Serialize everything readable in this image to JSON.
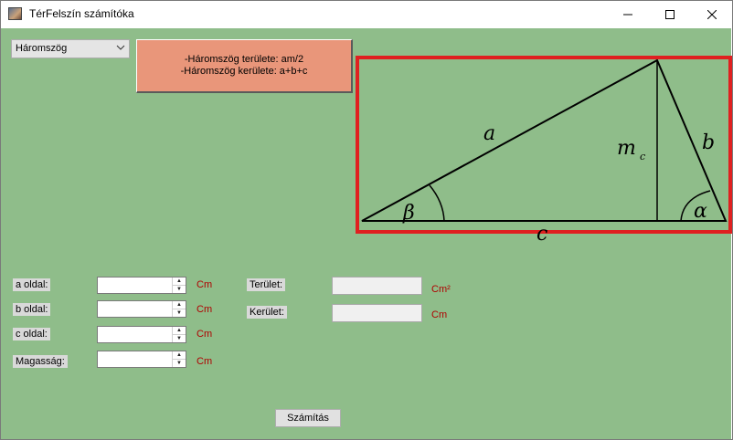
{
  "window": {
    "title": "TérFelszín számítóka"
  },
  "shape_select": {
    "value": "Háromszög"
  },
  "info": {
    "line1": "-Háromszög területe: am/2",
    "line2": "-Háromszög kerülete: a+b+c"
  },
  "figure": {
    "label_a": "a",
    "label_b": "b",
    "label_c": "c",
    "label_m": "m",
    "label_m_sub": "c",
    "label_alpha": "α",
    "label_beta": "β"
  },
  "inputs": [
    {
      "label": "a oldal:",
      "unit": "Cm",
      "value": ""
    },
    {
      "label": "b oldal:",
      "unit": "Cm",
      "value": ""
    },
    {
      "label": "c oldal:",
      "unit": "Cm",
      "value": ""
    },
    {
      "label": "Magasság:",
      "unit": "Cm",
      "value": ""
    }
  ],
  "outputs": [
    {
      "label": "Terület:",
      "unit": "Cm²",
      "value": ""
    },
    {
      "label": "Kerület:",
      "unit": "Cm",
      "value": ""
    }
  ],
  "calculate_button": {
    "label": "Számítás"
  }
}
